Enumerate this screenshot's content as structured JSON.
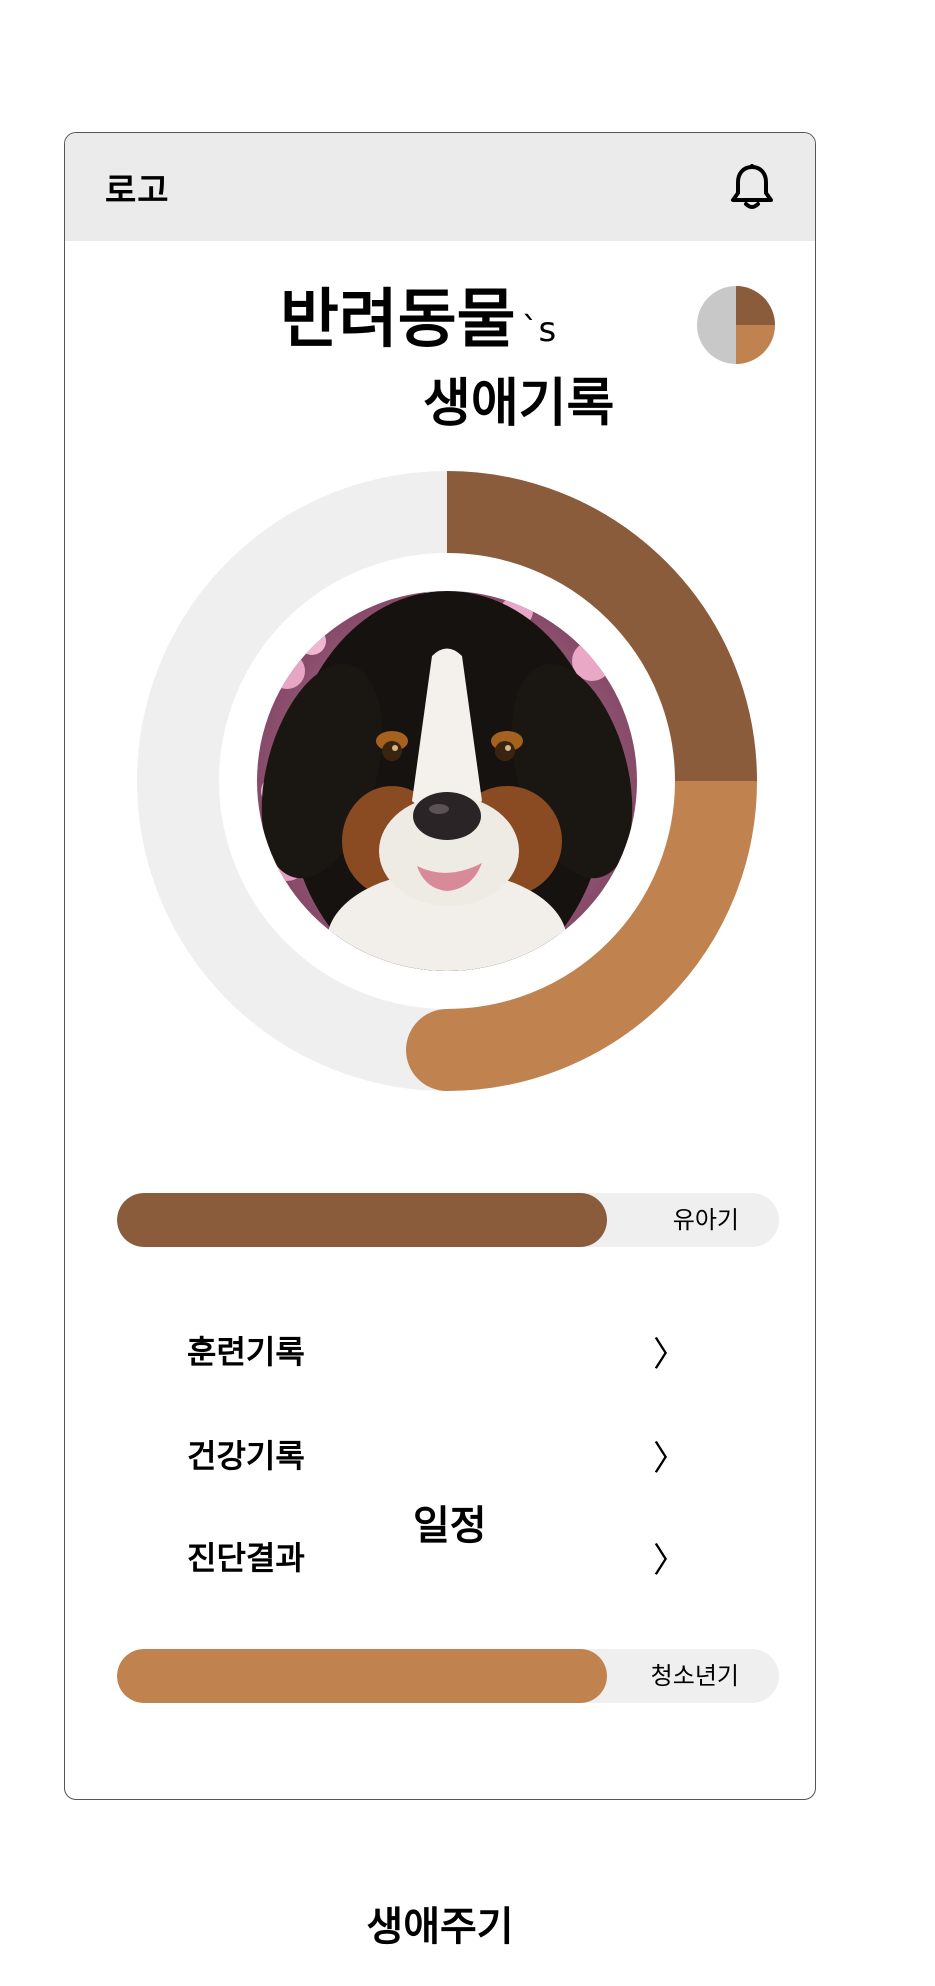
{
  "header": {
    "logo_text": "로고",
    "bell_icon": "bell-icon"
  },
  "title": {
    "line1": "반려동물",
    "suffix": "`s",
    "line2": "생애기록"
  },
  "colors": {
    "dark_brown": "#8a5c3c",
    "light_brown": "#c0834f",
    "ring_track": "#efefef",
    "pie_gray": "#c8c8c8"
  },
  "life_ring": {
    "dark_fraction": 0.25,
    "light_fraction": 0.25
  },
  "progress_bars": [
    {
      "label": "유아기",
      "fill_fraction": 0.74,
      "color": "#8a5c3c"
    },
    {
      "label": "청소년기",
      "fill_fraction": 0.74,
      "color": "#c0834f"
    }
  ],
  "menu": [
    {
      "label": "훈련기록",
      "chevron": "〉"
    },
    {
      "label": "건강기록",
      "chevron": "〉"
    },
    {
      "label": "진단결과",
      "chevron": "〉"
    }
  ],
  "schedule_label": "일정",
  "footer_title": "생애주기"
}
